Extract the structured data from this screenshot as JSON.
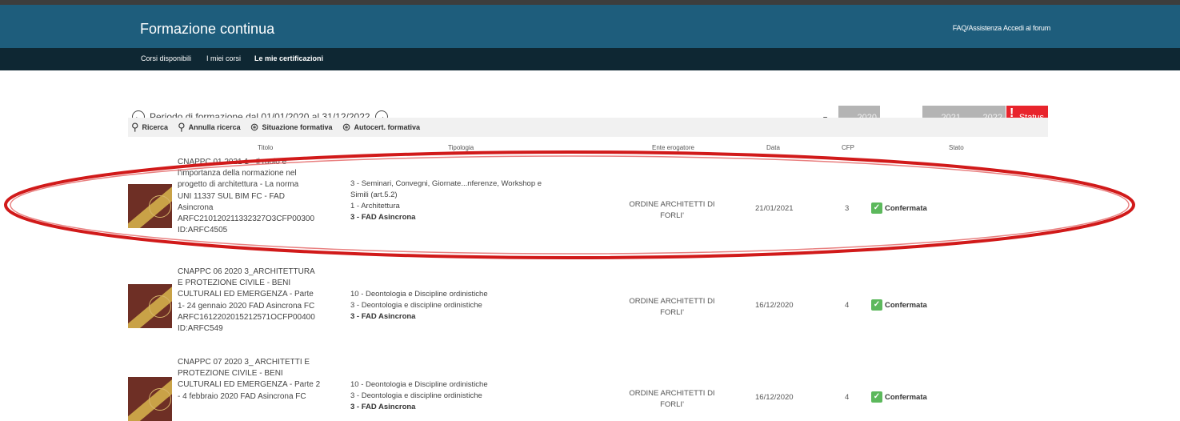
{
  "header": {
    "brand": "Formazione continua",
    "links": [
      "FAQ/Assistenza",
      "Accedi al forum"
    ]
  },
  "nav": {
    "items": [
      {
        "label": "Corsi disponibili",
        "active": false
      },
      {
        "label": "I miei corsi",
        "active": false
      },
      {
        "label": "Le mie certificazioni",
        "active": true
      }
    ]
  },
  "period": {
    "label": "Periodo di formazione dal 01/01/2020 al 31/12/2022"
  },
  "filters": {
    "years": [
      "2020",
      "2021",
      "2022"
    ],
    "status": "Status"
  },
  "toolbar": {
    "search": "Ricerca",
    "cancel_search": "Annulla ricerca",
    "situation": "Situazione formativa",
    "autocert": "Autocert. formativa"
  },
  "table": {
    "headers": [
      "Titolo",
      "Tipologia",
      "Ente erogatore",
      "Data",
      "CFP",
      "Stato"
    ],
    "rows": [
      {
        "title": [
          "CNAPPC 01 2021 1 - Il ruolo e",
          "l'importanza della normazione nel",
          "progetto di architettura - La norma",
          "UNI 11337 SUL BIM FC - FAD",
          "Asincrona",
          "ARFC210120211332327O3CFP00300",
          "ID:ARFC4505"
        ],
        "type": [
          "3 - Seminari, Convegni, Giornate...nferenze, Workshop e",
          "Simili (art.5.2)",
          "1 - Architettura"
        ],
        "type_bold": "3 - FAD Asincrona",
        "org": [
          "ORDINE ARCHITETTI DI",
          "FORLI'"
        ],
        "date": "21/01/2021",
        "cfp": "3",
        "state": "Confermata"
      },
      {
        "title": [
          "CNAPPC 06 2020 3_ARCHITETTURA",
          "E PROTEZIONE CIVILE - BENI",
          "CULTURALI ED EMERGENZA - Parte",
          "1- 24 gennaio 2020 FAD Asincrona FC",
          "ARFC1612202015212571OCFP00400",
          "ID:ARFC549"
        ],
        "type": [
          "10 - Deontologia e Discipline ordinistiche",
          "3 - Deontologia e discipline ordinistiche"
        ],
        "type_bold": "3 - FAD Asincrona",
        "org": [
          "ORDINE ARCHITETTI DI",
          "FORLI'"
        ],
        "date": "16/12/2020",
        "cfp": "4",
        "state": "Confermata"
      },
      {
        "title": [
          "CNAPPC 07 2020 3_ ARCHITETTI E",
          "PROTEZIONE CIVILE - BENI",
          "CULTURALI ED EMERGENZA - Parte 2",
          "- 4 febbraio 2020 FAD Asincrona FC"
        ],
        "type": [
          "10 - Deontologia e Discipline ordinistiche",
          "3 - Deontologia e discipline ordinistiche"
        ],
        "type_bold": "3 - FAD Asincrona",
        "org": [
          "ORDINE ARCHITETTI DI",
          "FORLI'"
        ],
        "date": "16/12/2020",
        "cfp": "4",
        "state": "Confermata"
      }
    ]
  }
}
